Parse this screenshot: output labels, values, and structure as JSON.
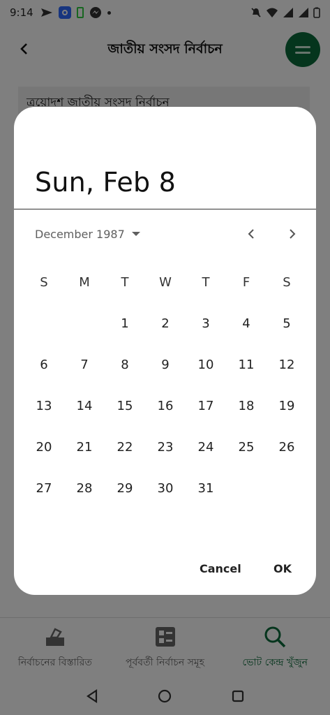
{
  "status_bar": {
    "time": "9:14"
  },
  "app": {
    "title": "জাতীয় সংসদ নির্বাচন",
    "election_dropdown_value": "ত্রয়োদশ জাতীয় সংসদ নির্বাচন",
    "colors": {
      "brand": "#0b6b3a"
    }
  },
  "bottom_nav": {
    "items": [
      {
        "label": "নির্বাচনের বিস্তারিত",
        "icon": "ballot-box-icon"
      },
      {
        "label": "পূর্ববর্তী নির্বাচন সমূহ",
        "icon": "list-grid-icon"
      },
      {
        "label": "ভোট কেন্দ্র খুঁজুন",
        "icon": "search-icon"
      }
    ],
    "active_index": 2
  },
  "date_picker": {
    "selected_date_text": "Sun, Feb 8",
    "month_label": "December 1987",
    "weekdays": [
      "S",
      "M",
      "T",
      "W",
      "T",
      "F",
      "S"
    ],
    "weeks": [
      [
        "",
        "",
        "1",
        "2",
        "3",
        "4",
        "5"
      ],
      [
        "6",
        "7",
        "8",
        "9",
        "10",
        "11",
        "12"
      ],
      [
        "13",
        "14",
        "15",
        "16",
        "17",
        "18",
        "19"
      ],
      [
        "20",
        "21",
        "22",
        "23",
        "24",
        "25",
        "26"
      ],
      [
        "27",
        "28",
        "29",
        "30",
        "31",
        "",
        ""
      ]
    ],
    "cancel_label": "Cancel",
    "ok_label": "OK"
  }
}
